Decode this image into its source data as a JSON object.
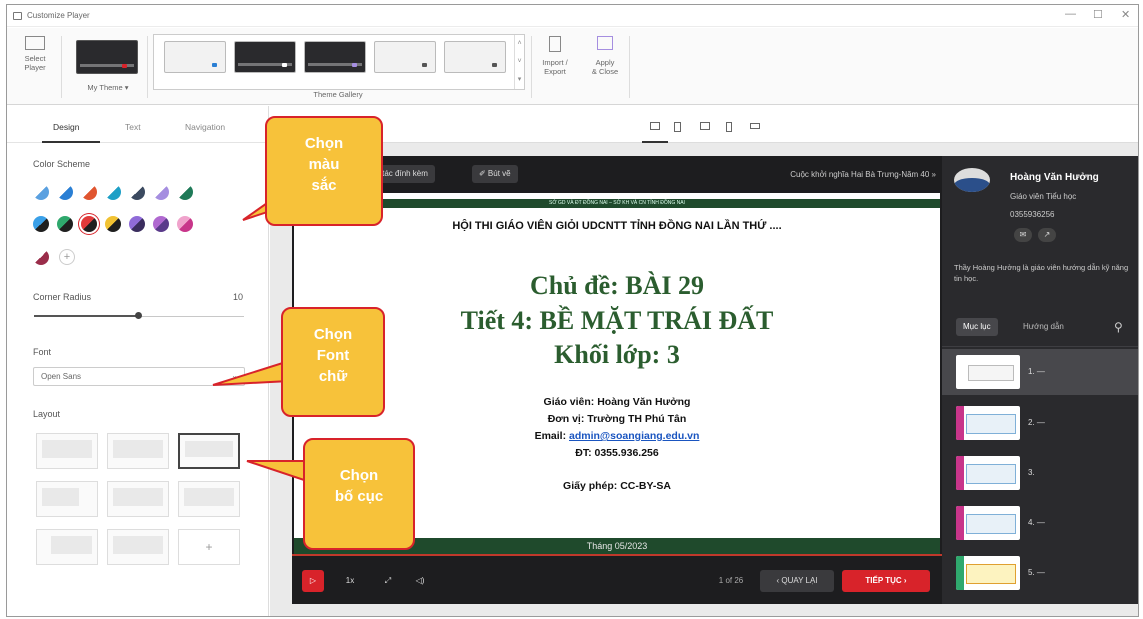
{
  "window": {
    "title": "Customize Player",
    "minimize": "—",
    "maximize": "☐",
    "close": "✕"
  },
  "ribbon": {
    "select_player": "Select\nPlayer",
    "my_theme": "My Theme ▾",
    "theme_gallery": "Theme Gallery",
    "import_export": "Import /\nExport",
    "apply_close": "Apply\n& Close"
  },
  "left_tabs": {
    "design": "Design",
    "text": "Text",
    "navigation": "Navigation"
  },
  "design": {
    "color_scheme_label": "Color Scheme",
    "swatches_top": [
      [
        "#5aa0e0",
        "#ffffff"
      ],
      [
        "#2a7fd4",
        "#ffffff"
      ],
      [
        "#e05530",
        "#ffffff"
      ],
      [
        "#1e9fc6",
        "#ffffff"
      ],
      [
        "#3b4a60",
        "#ffffff"
      ],
      [
        "#a58ee0",
        "#ffffff"
      ],
      [
        "#1f7a58",
        "#ffffff"
      ]
    ],
    "swatches_bottom": [
      [
        "#1f1f1f",
        "#3aa0e8"
      ],
      [
        "#1f1f1f",
        "#2fa86d"
      ],
      [
        "#1f1f1f",
        "#e03a3a"
      ],
      [
        "#1f1f1f",
        "#f1c232"
      ],
      [
        "#3a2d5e",
        "#8f6bd8"
      ],
      [
        "#5a3a8a",
        "#b069d0"
      ],
      [
        "#c8358a",
        "#f0a3cc"
      ]
    ],
    "swatch_extra": [
      "#9a2d4a",
      "#ffffff"
    ],
    "add_swatch": "+",
    "corner_radius_label": "Corner Radius",
    "corner_radius_value": "10",
    "corner_radius_fraction": 0.5,
    "font_label": "Font",
    "font_value": "Open Sans",
    "layout_label": "Layout",
    "layout_add": "+"
  },
  "player": {
    "attachments": "ng tác đính kèm",
    "notes": "✐ Bút vẽ",
    "breadcrumb": "Cuộc khởi nghĩa Hai Bà Trưng-Năm 40  »",
    "slide": {
      "strip": "SỞ GD VÀ ĐT ĐỒNG NAI – SỞ KH VÀ CN TỈNH ĐỒNG NAI",
      "contest": "HỘI THI GIÁO VIÊN GIỎI UDCNTT TỈNH ĐỒNG NAI LẦN THỨ ....",
      "topic": "Chủ đề: BÀI 29",
      "lesson": "Tiết 4: BỀ MẶT TRÁI ĐẤT",
      "grade": "Khối lớp: 3",
      "teacher": "Giáo viên: Hoàng Văn Hưởng",
      "unit": "Đơn vị: Trường TH Phú Tân",
      "email_label": "Email: ",
      "email": "admin@soangiang.edu.vn",
      "phone": "ĐT: 0355.936.256",
      "license": "Giấy phép: CC-BY-SA",
      "footer": "Tháng 05/2023"
    },
    "controls": {
      "play": "▷",
      "speed": "1x",
      "fullscreen": "⤢",
      "volume": "◁)",
      "counter": "1 of 26",
      "prev": "‹  QUAY LẠI",
      "next": "TIẾP TỤC  ›"
    },
    "accent": "#d8232a"
  },
  "presenter": {
    "name": "Hoàng Văn Hưởng",
    "role": "Giáo viên Tiểu học",
    "phone": "0355936256",
    "bio": "Thầy Hoàng Hưởng là giáo viên hướng dẫn kỹ năng tin học.",
    "btn_mail": "✉",
    "btn_link": "↗",
    "tab_toc": "Mục lục",
    "tab_guide": "Hướng dẫn",
    "search_icon": "⚲",
    "toc": [
      {
        "label": "1. —"
      },
      {
        "label": "2. —"
      },
      {
        "label": "3."
      },
      {
        "label": "4. —"
      },
      {
        "label": "5. —"
      }
    ]
  },
  "callouts": {
    "color": "Chọn\nmàu\nsắc",
    "font": "Chọn\nFont\nchữ",
    "layout": "Chọn\nbố cục"
  }
}
